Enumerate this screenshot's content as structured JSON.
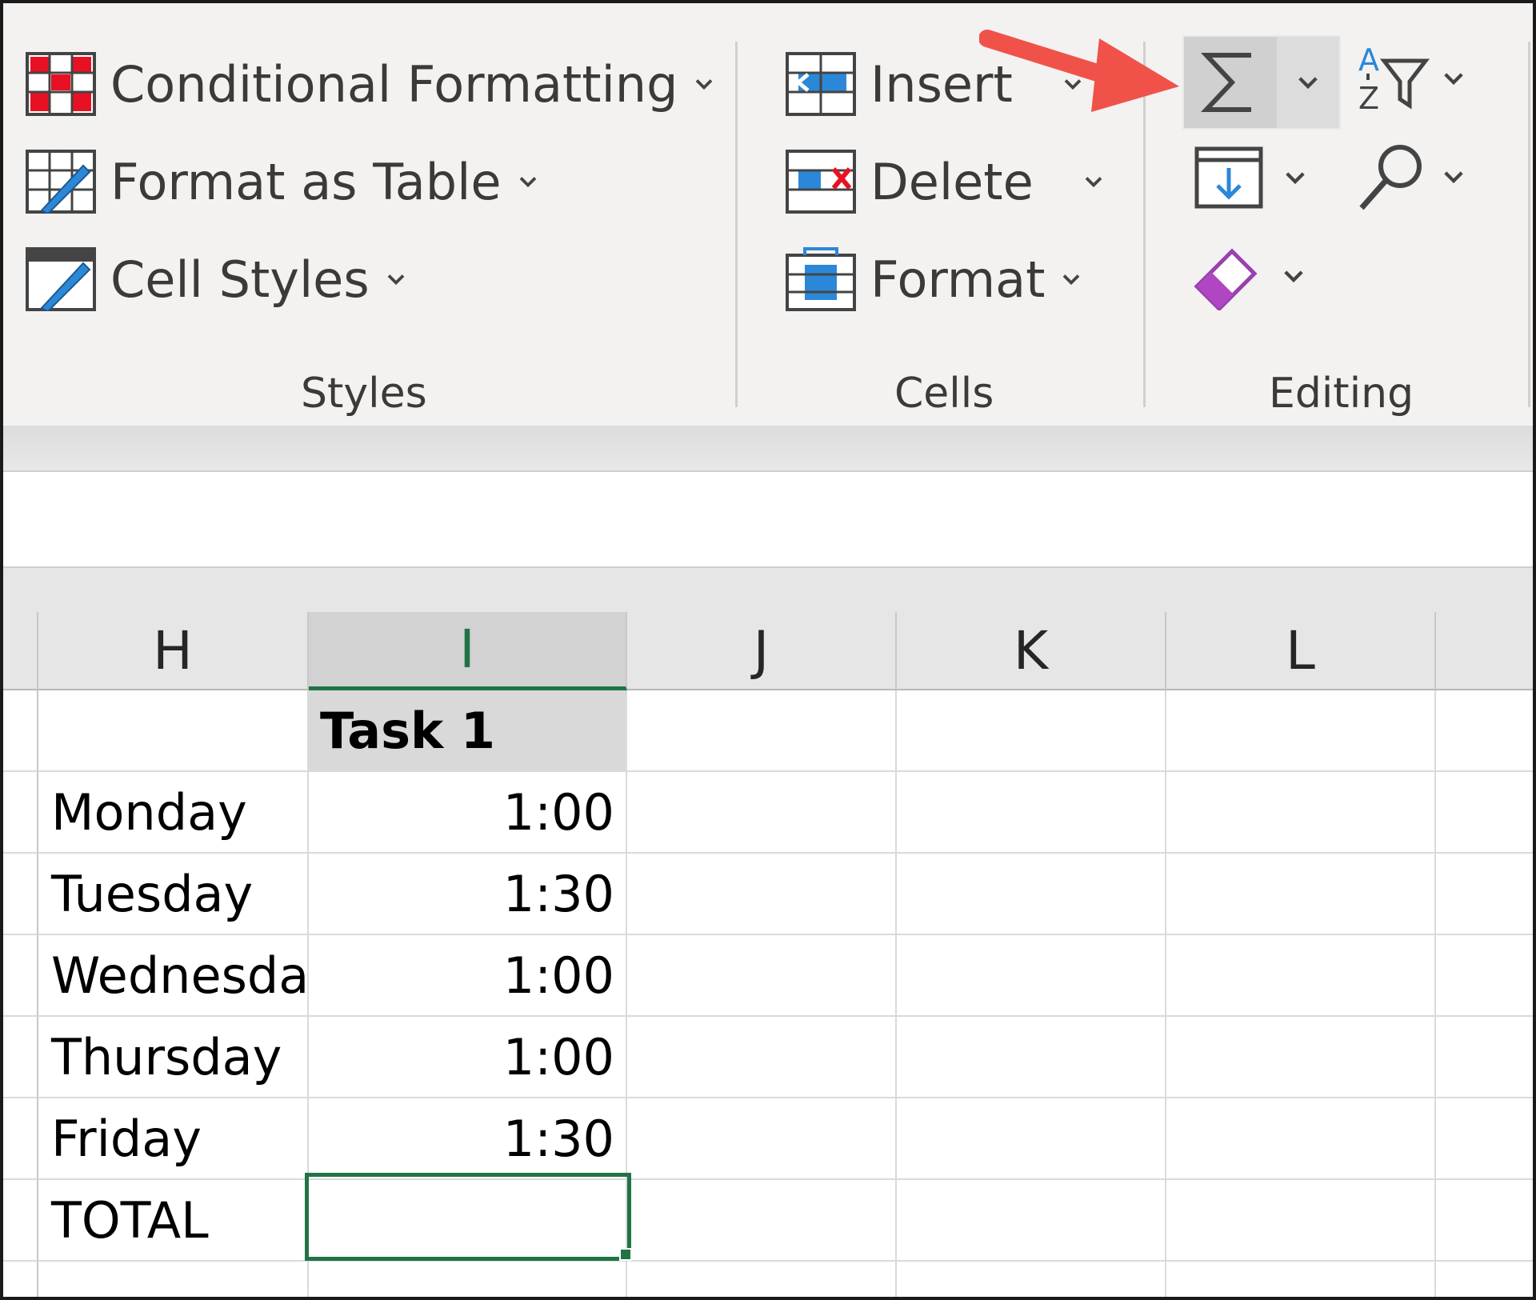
{
  "ribbon": {
    "styles": {
      "conditional_formatting": "Conditional Formatting",
      "format_as_table": "Format as Table",
      "cell_styles": "Cell Styles",
      "group_label": "Styles"
    },
    "cells": {
      "insert": "Insert",
      "delete": "Delete",
      "format": "Format",
      "group_label": "Cells"
    },
    "editing": {
      "group_label": "Editing",
      "buttons": [
        "autosum-icon",
        "sort-filter-icon",
        "fill-icon",
        "find-icon",
        "clear-icon"
      ]
    }
  },
  "sheet": {
    "columns": [
      "H",
      "I",
      "J",
      "K",
      "L"
    ],
    "selected_column": "I",
    "header": "Task 1",
    "rows": [
      {
        "label": "Monday",
        "value": "1:00"
      },
      {
        "label": "Tuesday",
        "value": "1:30"
      },
      {
        "label": "Wednesda",
        "value": "1:00"
      },
      {
        "label": "Thursday",
        "value": "1:00"
      },
      {
        "label": "Friday",
        "value": "1:30"
      },
      {
        "label": "TOTAL",
        "value": ""
      }
    ]
  },
  "colors": {
    "accent_green": "#217346",
    "annotation_arrow": "#f0524a",
    "clear_icon": "#b146c2",
    "icon_blue": "#2b88d8",
    "icon_red": "#e81123"
  }
}
